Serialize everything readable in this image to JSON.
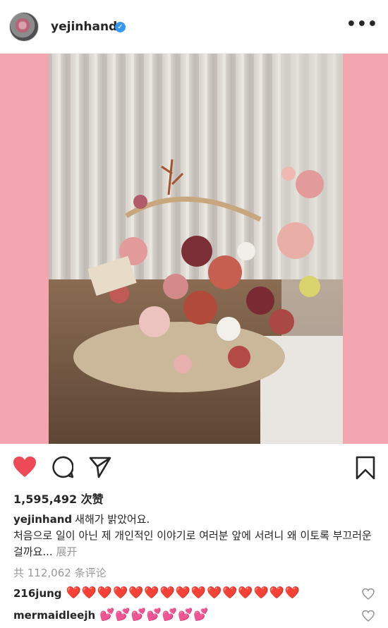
{
  "header": {
    "username": "yejinhand",
    "verified_icon": "verified-badge-icon",
    "more_icon": "more-options-icon"
  },
  "post": {
    "image_description_icon": "flower-basket-photo",
    "likes_text": "1,595,492 次赞",
    "caption_user": "yejinhand",
    "caption_line1": "새해가 밝았어요.",
    "caption_line2": "처음으로 일이 아닌 제 개인적인 이야기로 여러분 앞에 서려니 왜 이토록 부끄러운걸까요...",
    "expand_label": "展开",
    "view_comments": "共 112,062 条评论"
  },
  "comments": [
    {
      "user": "216jung",
      "text": "❤️❤️❤️❤️❤️❤️❤️❤️❤️❤️❤️❤️❤️❤️❤️"
    },
    {
      "user": "mermaidleejh",
      "text": "💕💕💕💕💕💕💕"
    }
  ],
  "colors": {
    "like_red": "#ed4956",
    "pink_frame": "#f4a6b0",
    "verified_blue": "#3897f0",
    "muted_text": "#999999"
  }
}
